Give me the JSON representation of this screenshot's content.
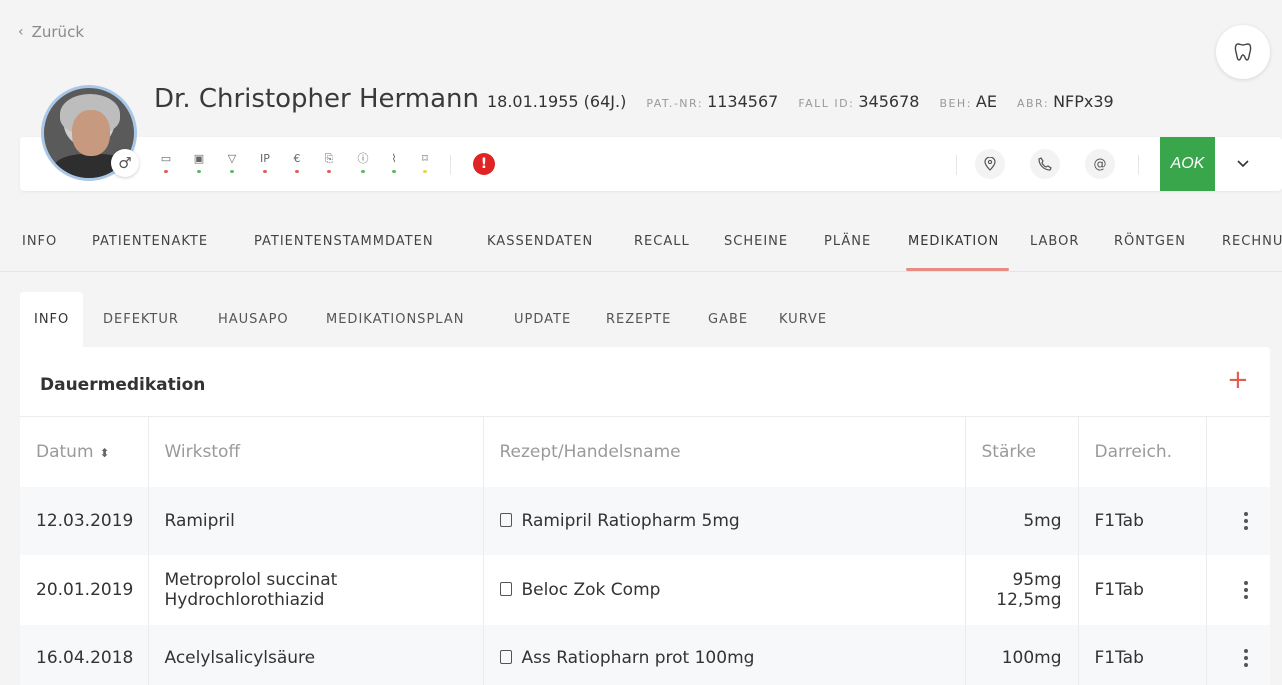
{
  "nav": {
    "back_label": "Zurück"
  },
  "patient": {
    "name": "Dr. Christopher Hermann",
    "dob": "18.01.1955 (64J.)",
    "patnr_label": "PAT.-NR:",
    "patnr": "1134567",
    "fallid_label": "FALL ID:",
    "fallid": "345678",
    "beh_label": "BEH:",
    "beh": "AE",
    "abr_label": "ABR:",
    "abr": "NFPx39",
    "gender_symbol": "♂"
  },
  "icons": [
    {
      "name": "comment-icon",
      "glyph": "▭",
      "dot": "#e25c52"
    },
    {
      "name": "card-icon",
      "glyph": "▣",
      "dot": "#5cb85c"
    },
    {
      "name": "filter-icon",
      "glyph": "▽",
      "dot": "#5cb85c"
    },
    {
      "name": "ip-icon",
      "glyph": "IP",
      "dot": "#e25c52"
    },
    {
      "name": "euro-icon",
      "glyph": "€",
      "dot": "#e25c52"
    },
    {
      "name": "receipt-icon",
      "glyph": "⎘",
      "dot": "#e25c52"
    },
    {
      "name": "info-icon",
      "glyph": "ⓘ",
      "dot": "#5cb85c"
    },
    {
      "name": "attachment-icon",
      "glyph": "⌇",
      "dot": "#5cb85c"
    },
    {
      "name": "tag-icon",
      "glyph": "⌑",
      "dot": "#e8d24a"
    }
  ],
  "insurance": {
    "logo_text": "AOK"
  },
  "main_tabs": [
    {
      "label": "INFO"
    },
    {
      "label": "PATIENTENAKTE"
    },
    {
      "label": "PATIENTENSTAMMDATEN"
    },
    {
      "label": "KASSENDATEN"
    },
    {
      "label": "RECALL"
    },
    {
      "label": "SCHEINE"
    },
    {
      "label": "PLÄNE"
    },
    {
      "label": "MEDIKATION"
    },
    {
      "label": "LABOR"
    },
    {
      "label": "RÖNTGEN"
    },
    {
      "label": "RECHNU"
    }
  ],
  "sub_tabs": [
    {
      "label": "INFO"
    },
    {
      "label": "DEFEKTUR"
    },
    {
      "label": "HAUSAPO"
    },
    {
      "label": "MEDIKATIONSPLAN"
    },
    {
      "label": "UPDATE"
    },
    {
      "label": "REZEPTE"
    },
    {
      "label": "GABE"
    },
    {
      "label": "KURVE"
    }
  ],
  "panel": {
    "title": "Dauermedikation",
    "add_symbol": "+"
  },
  "table": {
    "headers": [
      "Datum",
      "Wirkstoff",
      "Rezept/Handelsname",
      "Stärke",
      "Darreich."
    ],
    "sort_symbol": "⬍",
    "rows": [
      {
        "datum": "12.03.2019",
        "wirkstoff": [
          "Ramipril"
        ],
        "rezept": "Ramipril Ratiopharm 5mg",
        "staerke": [
          "5mg"
        ],
        "darreich": "F1Tab"
      },
      {
        "datum": "20.01.2019",
        "wirkstoff": [
          "Metroprolol succinat",
          "Hydrochlorothiazid"
        ],
        "rezept": "Beloc Zok Comp",
        "staerke": [
          "95mg",
          "12,5mg"
        ],
        "darreich": "F1Tab"
      },
      {
        "datum": "16.04.2018",
        "wirkstoff": [
          "Acelylsalicylsäure"
        ],
        "rezept": "Ass Ratiopharn prot 100mg",
        "staerke": [
          "100mg"
        ],
        "darreich": "F1Tab"
      }
    ]
  }
}
